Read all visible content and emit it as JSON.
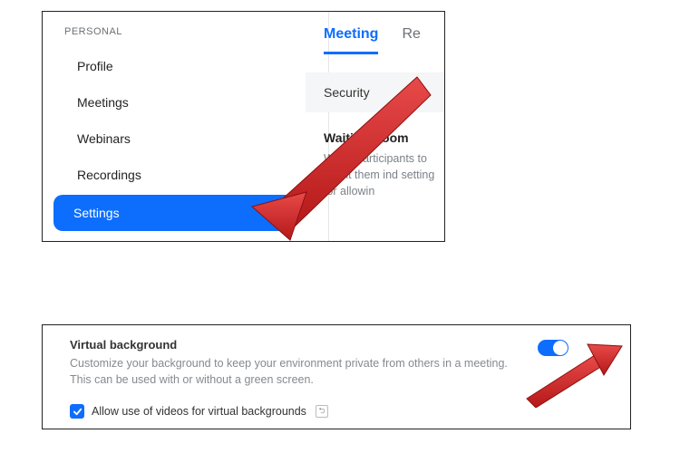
{
  "sidebar": {
    "header": "PERSONAL",
    "items": [
      {
        "label": "Profile"
      },
      {
        "label": "Meetings"
      },
      {
        "label": "Webinars"
      },
      {
        "label": "Recordings"
      },
      {
        "label": "Settings"
      }
    ]
  },
  "tabs": {
    "items": [
      {
        "label": "Meeting"
      },
      {
        "label": "Re"
      }
    ]
  },
  "subnav": {
    "label": "Security"
  },
  "waiting_room": {
    "title": "Waiting Room",
    "desc": "When participants to admit them ind setting for allowin"
  },
  "virtual_bg": {
    "title": "Virtual background",
    "desc": "Customize your background to keep your environment private from others in a meeting. This can be used with or without a green screen.",
    "checkbox_label": "Allow use of videos for virtual backgrounds",
    "help_glyph": "⮌"
  },
  "colors": {
    "accent": "#0d6efd",
    "arrow": "#d62222"
  }
}
